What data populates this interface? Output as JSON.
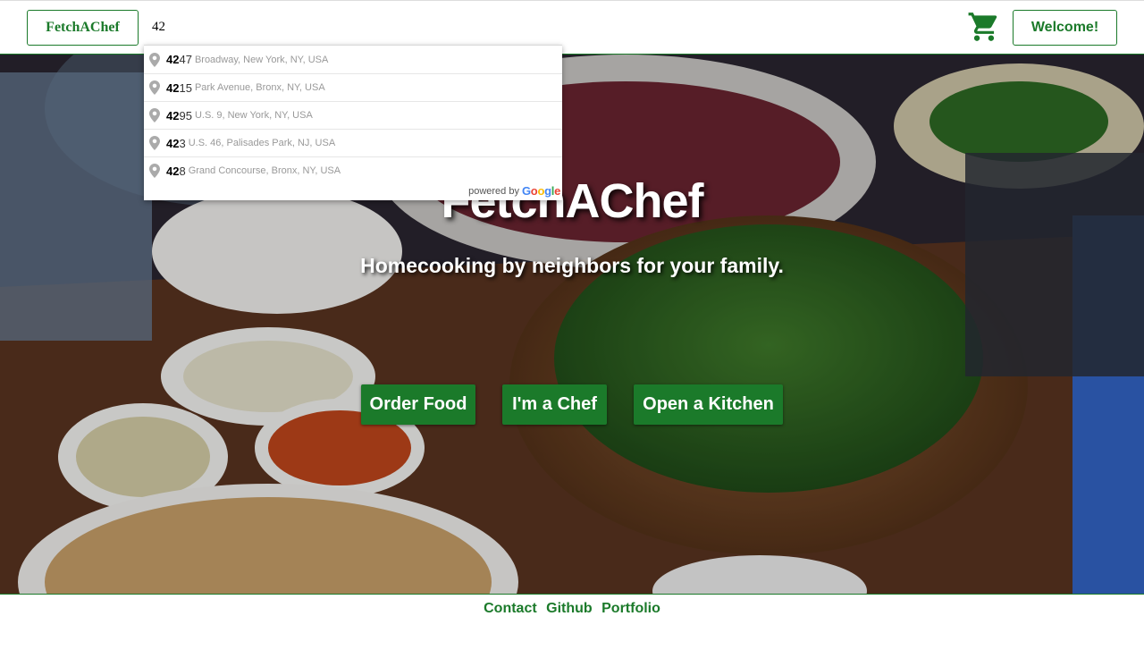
{
  "header": {
    "brand_label": "FetchAChef",
    "search_value": "42",
    "cart_icon": "shopping-cart-icon",
    "welcome_label": "Welcome!"
  },
  "autocomplete": {
    "suggestions": [
      {
        "match": "42",
        "rest_num": "47",
        "address": "Broadway, New York, NY, USA"
      },
      {
        "match": "42",
        "rest_num": "15",
        "address": "Park Avenue, Bronx, NY, USA"
      },
      {
        "match": "42",
        "rest_num": "95",
        "address": "U.S. 9, New York, NY, USA"
      },
      {
        "match": "42",
        "rest_num": "3",
        "address": "U.S. 46, Palisades Park, NJ, USA"
      },
      {
        "match": "42",
        "rest_num": "8",
        "address": "Grand Concourse, Bronx, NY, USA"
      }
    ],
    "powered_by": "powered by",
    "google": "Google"
  },
  "hero": {
    "title": "FetchAChef",
    "subtitle": "Homecooking by neighbors for your family.",
    "buttons": {
      "order": "Order Food",
      "chef": "I'm a Chef",
      "kitchen": "Open a Kitchen"
    }
  },
  "footer": {
    "links": [
      "Contact",
      "Github",
      "Portfolio"
    ]
  },
  "colors": {
    "brand_green": "#1b7a2a"
  }
}
